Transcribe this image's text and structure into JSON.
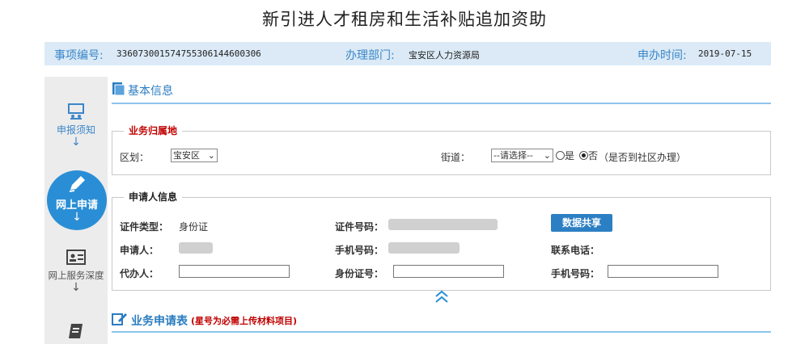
{
  "page": {
    "title": "新引进人才租房和生活补贴追加资助"
  },
  "info_bar": {
    "item_no_label": "事项编号:",
    "item_no_value": "336073001574755306144600306",
    "dept_label": "办理部门:",
    "dept_value": "宝安区人力资源局",
    "time_label": "申办时间:",
    "time_value": "2019-07-15"
  },
  "sidebar": {
    "items": [
      {
        "label": "申报须知",
        "arrow": "↓",
        "icon": "presentation-icon"
      },
      {
        "label": "网上申请",
        "arrow": "↓",
        "icon": "pencil-icon"
      },
      {
        "label": "网上服务深度",
        "arrow": "↓",
        "icon": "id-card-icon"
      },
      {
        "label": "",
        "arrow": "",
        "icon": "scroll-icon"
      }
    ]
  },
  "basic_info": {
    "title": "基本信息"
  },
  "business_location": {
    "legend": "业务归属地",
    "district_label": "区划：",
    "district_value": "宝安区",
    "street_label": "街道：",
    "street_value": "--请选择--",
    "radio_yes": "是",
    "radio_no": "否",
    "radio_note": "（是否到社区办理）",
    "radio_selected": "否"
  },
  "applicant": {
    "legend": "申请人信息",
    "id_type_label": "证件类型：",
    "id_type_value": "身份证",
    "id_no_label": "证件号码：",
    "share_button": "数据共享",
    "name_label": "申请人：",
    "mobile_label": "手机号码：",
    "contact_label": "联系电话：",
    "agent_label": "代办人：",
    "agent_id_label": "身份证号：",
    "agent_mobile_label": "手机号码："
  },
  "business_form": {
    "title": "业务申请表",
    "note": "(星号为必需上传材料项目)"
  },
  "colors": {
    "accent": "#2a8ed6",
    "info_bar_bg": "#dbeaf6",
    "label_blue": "#3a86c8",
    "legend_red": "#c00000"
  }
}
